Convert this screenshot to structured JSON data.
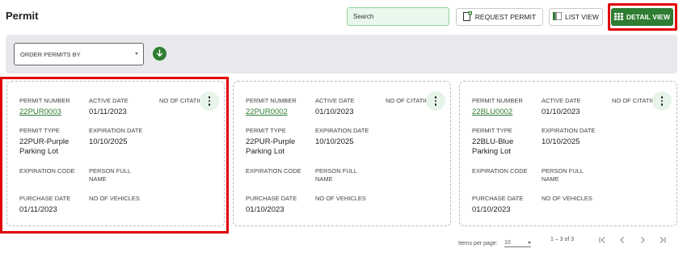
{
  "header": {
    "title": "Permit",
    "search_placeholder": "Search",
    "request_permit_label": "REQUEST PERMIT",
    "list_view_label": "LIST VIEW",
    "detail_view_label": "DETAIL VIEW"
  },
  "filter": {
    "order_by_label": "ORDER PERMITS BY"
  },
  "labels": {
    "permit_number": "PERMIT NUMBER",
    "active_date": "ACTIVE DATE",
    "no_of_citations": "NO OF CITATIONS",
    "permit_type": "PERMIT TYPE",
    "expiration_date": "EXPIRATION DATE",
    "expiration_code": "EXPIRATION CODE",
    "person_full_name": "PERSON FULL NAME",
    "purchase_date": "PURCHASE DATE",
    "no_of_vehicles": "NO OF VEHICLES"
  },
  "cards": [
    {
      "permit_number": "22PUR0003",
      "active_date": "01/11/2023",
      "permit_type": "22PUR-Purple Parking Lot",
      "expiration_date": "10/10/2025",
      "purchase_date": "01/11/2023"
    },
    {
      "permit_number": "22PUR0002",
      "active_date": "01/10/2023",
      "permit_type": "22PUR-Purple Parking Lot",
      "expiration_date": "10/10/2025",
      "purchase_date": "01/10/2023"
    },
    {
      "permit_number": "22BLU0002",
      "active_date": "01/10/2023",
      "permit_type": "22BLU-Blue Parking Lot",
      "expiration_date": "10/10/2025",
      "purchase_date": "01/10/2023"
    }
  ],
  "pagination": {
    "items_per_page_label": "Items per page:",
    "items_per_page_value": "10",
    "range_text": "1 – 3 of 3"
  },
  "colors": {
    "primary_green": "#2e7d32",
    "highlight_red": "#e00000",
    "filter_bar_bg": "#e8e9ec"
  },
  "icons": {
    "request_permit": "add-document-icon",
    "list_view": "list-view-icon",
    "detail_view": "grid-view-icon",
    "sort": "arrow-down-icon",
    "card_menu": "more-vertical-icon"
  }
}
